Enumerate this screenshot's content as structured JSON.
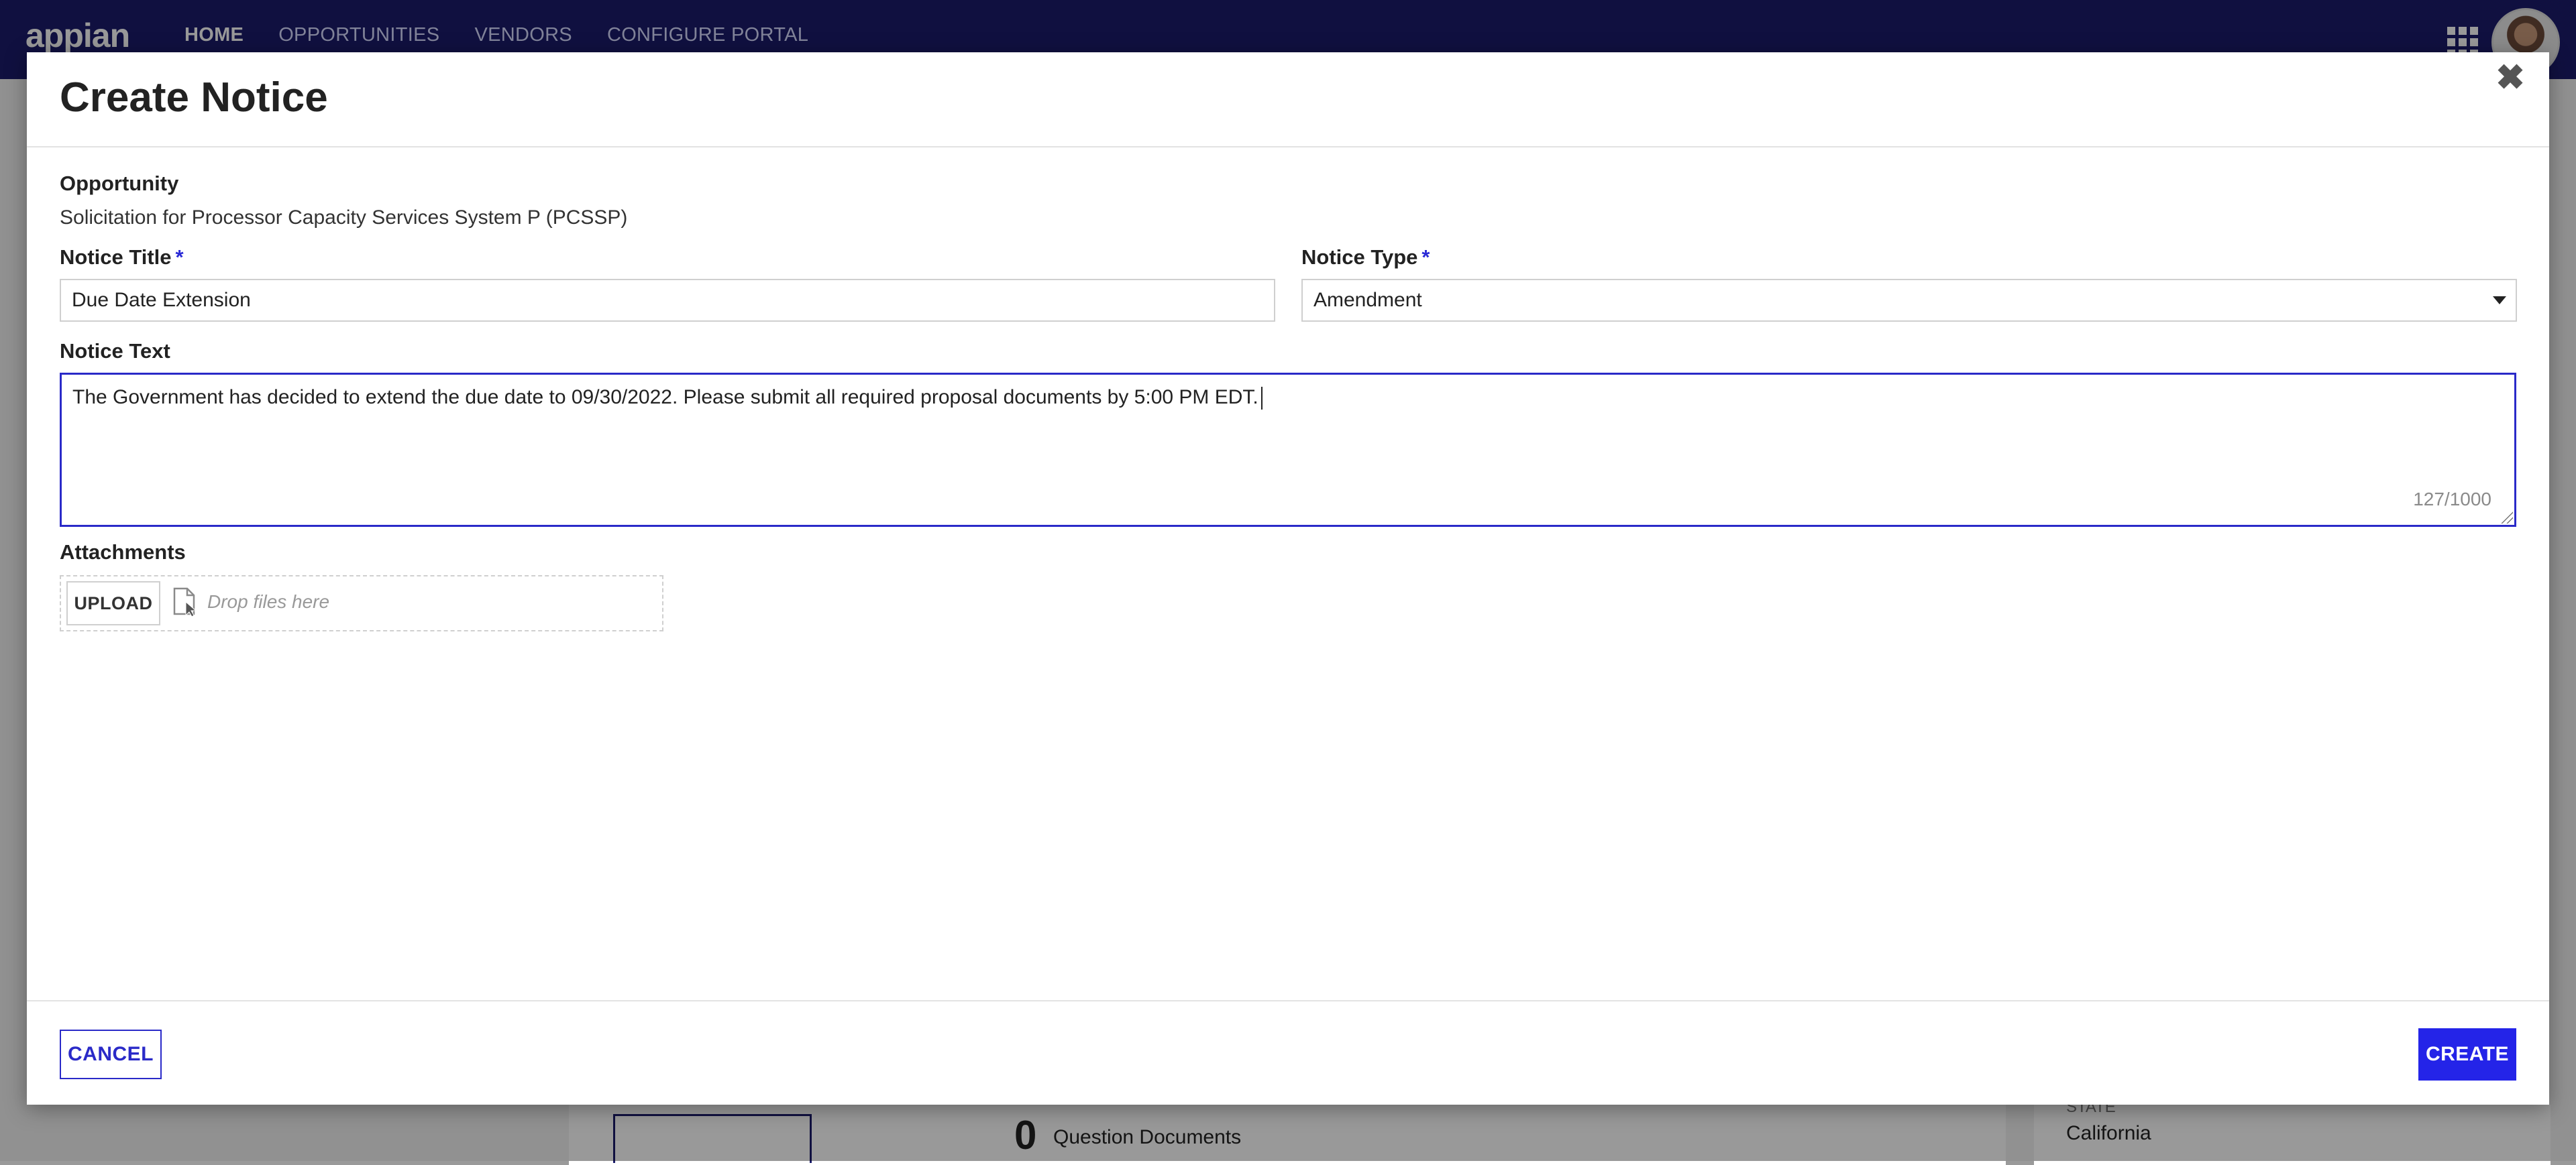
{
  "app": {
    "logo": "appian",
    "nav": [
      "HOME",
      "OPPORTUNITIES",
      "VENDORS",
      "CONFIGURE PORTAL"
    ]
  },
  "background": {
    "count": "0",
    "count_label": "Question Documents",
    "state_label": "STATE",
    "state_value": "California"
  },
  "modal": {
    "title": "Create Notice",
    "opportunity_label": "Opportunity",
    "opportunity_value": "Solicitation for Processor Capacity Services System P (PCSSP)",
    "notice_title_label": "Notice Title",
    "notice_title_value": "Due Date Extension",
    "notice_type_label": "Notice Type",
    "notice_type_value": "Amendment",
    "required_marker": "*",
    "notice_text_label": "Notice Text",
    "notice_text_value": "The Government has decided to extend the due date to 09/30/2022. Please submit all required proposal documents by 5:00 PM EDT.",
    "char_count": "127/1000",
    "attachments_label": "Attachments",
    "upload_label": "UPLOAD",
    "drop_placeholder": "Drop files here",
    "cancel_label": "CANCEL",
    "create_label": "CREATE",
    "close_glyph": "✖"
  },
  "colors": {
    "nav_bg": "#1b1c6b",
    "accent": "#2424e8",
    "focus_border": "#2a2ac8"
  },
  "icons": [
    "apps-grid-icon",
    "avatar",
    "close-icon",
    "file-icon",
    "dropdown-arrow-icon"
  ]
}
